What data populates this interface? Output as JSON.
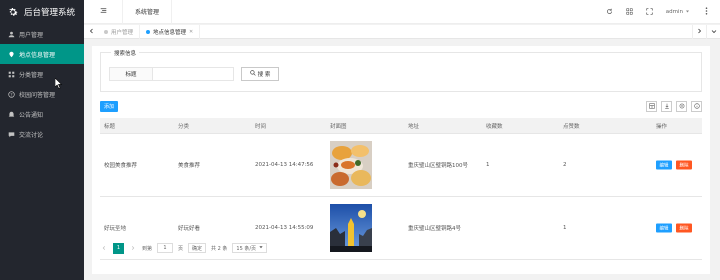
{
  "app": {
    "title": "后台管理系统"
  },
  "sidebar": {
    "items": [
      {
        "label": "用户管理",
        "icon": "user-icon"
      },
      {
        "label": "地点信息管理",
        "icon": "location-icon",
        "active": true
      },
      {
        "label": "分类管理",
        "icon": "category-icon"
      },
      {
        "label": "校园问答管理",
        "icon": "qa-icon"
      },
      {
        "label": "公告通知",
        "icon": "notice-icon"
      },
      {
        "label": "交流讨论",
        "icon": "chat-icon"
      }
    ]
  },
  "header": {
    "system_tab": "系统管理",
    "user": "admin"
  },
  "tabs": [
    {
      "label": "用户管理",
      "active": false
    },
    {
      "label": "地点信息管理",
      "active": true
    }
  ],
  "search": {
    "legend": "搜索信息",
    "field_label": "标题",
    "field_value": "",
    "button_label": "搜 索"
  },
  "toolbar": {
    "add_label": "添加"
  },
  "table": {
    "columns": [
      "标题",
      "分类",
      "时间",
      "封面图",
      "地址",
      "收藏数",
      "点赞数",
      "操作"
    ],
    "rows": [
      {
        "title": "校园美食推荐",
        "category": "美食推荐",
        "time": "2021-04-13 14:47:56",
        "address": "重庆璧山区璧铜路100号",
        "favorites": "1",
        "likes": "2",
        "edit": "编辑",
        "delete": "删除"
      },
      {
        "title": "好玩圣地",
        "category": "好玩好看",
        "time": "2021-04-13 14:55:09",
        "address": "重庆璧山区璧铜路4号",
        "favorites": "",
        "likes": "1",
        "edit": "编辑",
        "delete": "删除"
      }
    ]
  },
  "pager": {
    "current": "1",
    "goto_prefix": "到第",
    "goto_value": "1",
    "goto_suffix": "页",
    "confirm": "确定",
    "total": "共 2 条",
    "page_size": "15 条/页"
  },
  "colors": {
    "sidebar": "#23262e",
    "active": "#009688",
    "primary": "#1e9fff",
    "danger": "#ff5722"
  }
}
